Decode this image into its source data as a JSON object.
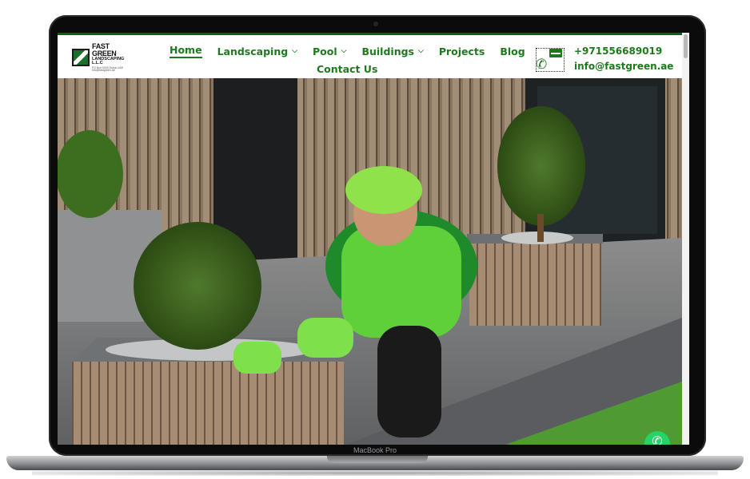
{
  "device": {
    "label": "MacBook Pro"
  },
  "header": {
    "logo": {
      "name": "FAST GREEN",
      "subtitle": "LANDSCAPING L.L.C",
      "fine_print": "PO Box 0000 Dubai UAE info@fastgreen.ae"
    },
    "nav": [
      {
        "label": "Home",
        "active": true,
        "has_dropdown": false
      },
      {
        "label": "Landscaping",
        "active": false,
        "has_dropdown": true
      },
      {
        "label": "Pool",
        "active": false,
        "has_dropdown": true
      },
      {
        "label": "Buildings",
        "active": false,
        "has_dropdown": true
      },
      {
        "label": "Projects",
        "active": false,
        "has_dropdown": false
      },
      {
        "label": "Blog",
        "active": false,
        "has_dropdown": false
      },
      {
        "label": "Contact Us",
        "active": false,
        "has_dropdown": false
      }
    ],
    "contact": {
      "phone": "+971556689019",
      "email": "info@fastgreen.ae",
      "icons": [
        "mail-icon",
        "phone-icon"
      ]
    }
  },
  "hero": {
    "image_alt": "Gardener in green uniform tending a pine plant in a wooden planter",
    "whatsapp_icon": "whatsapp-icon"
  },
  "colors": {
    "brand_green": "#1d7a1d",
    "header_border": "#0d5e1a",
    "whatsapp": "#25d366"
  }
}
